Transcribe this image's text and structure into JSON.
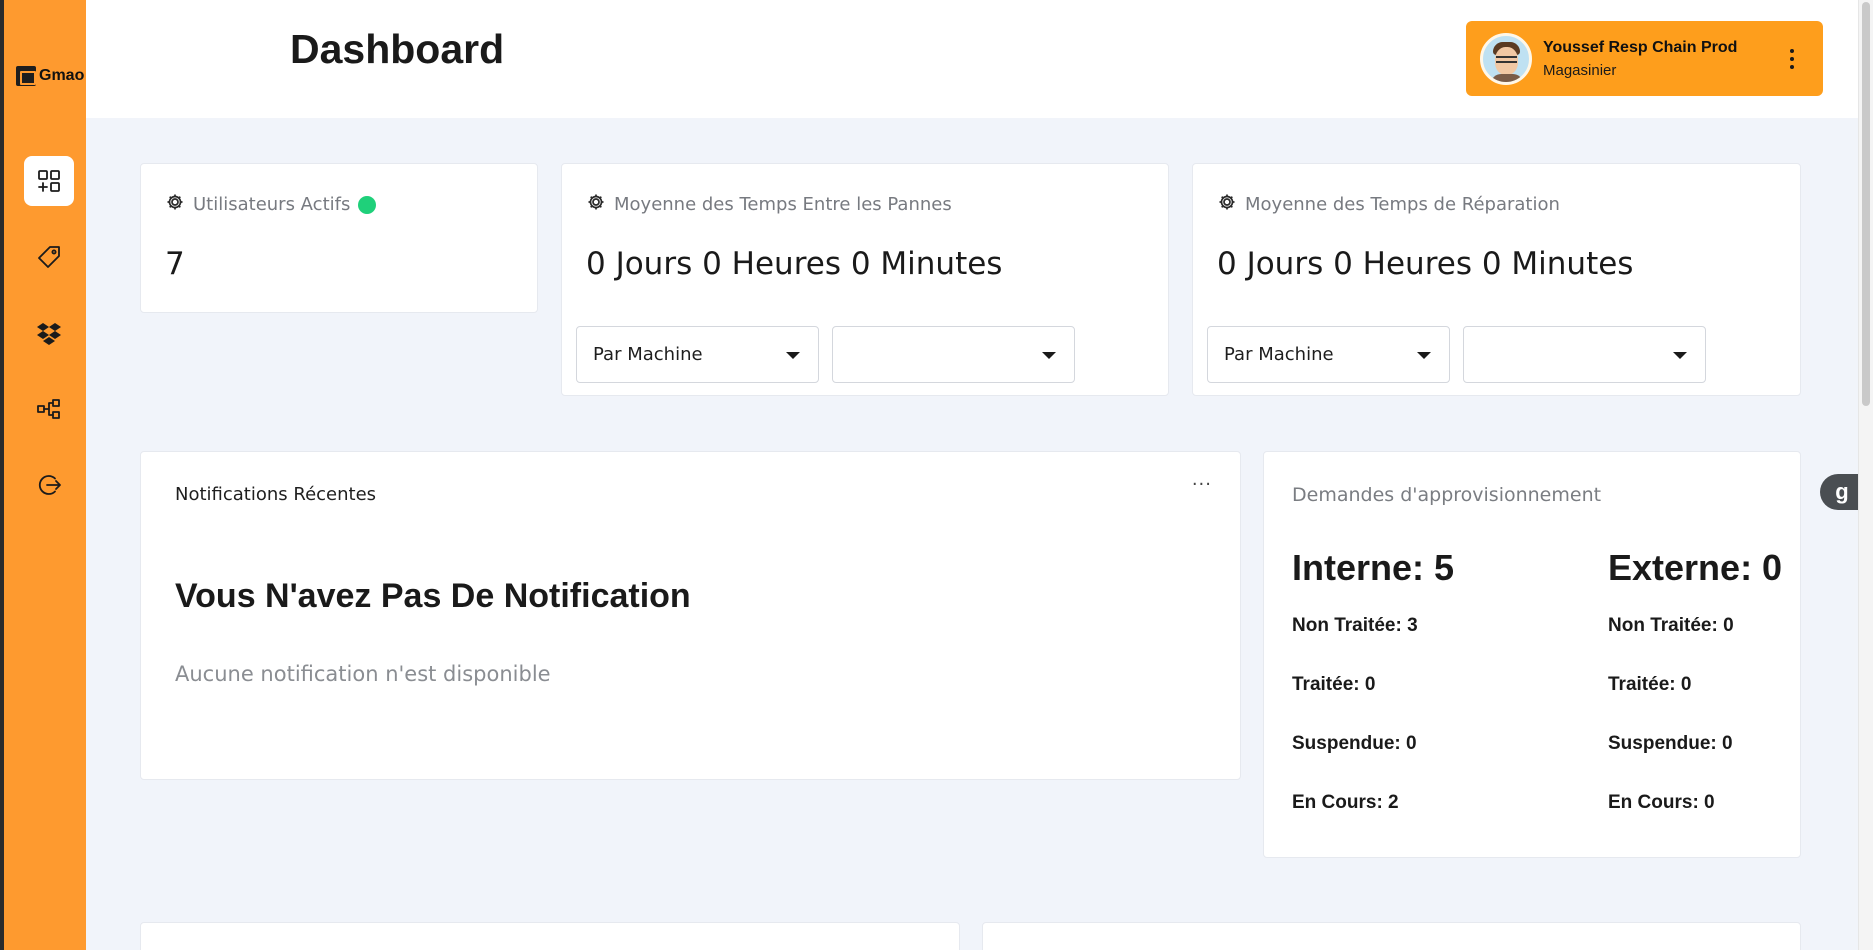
{
  "app": {
    "logo_text": "Gmao",
    "page_title": "Dashboard"
  },
  "sidebar": {
    "items": [
      {
        "name": "dashboard",
        "icon": "dashboard-grid-icon",
        "active": true
      },
      {
        "name": "tag",
        "icon": "tag-icon",
        "active": false
      },
      {
        "name": "dropbox",
        "icon": "boxes-icon",
        "active": false
      },
      {
        "name": "hierarchy",
        "icon": "hierarchy-icon",
        "active": false
      },
      {
        "name": "logout",
        "icon": "logout-icon",
        "active": false
      }
    ]
  },
  "user": {
    "name": "Youssef Resp Chain Prod",
    "role": "Magasinier"
  },
  "stats": {
    "active_users": {
      "label": "Utilisateurs Actifs",
      "value": "7"
    },
    "mtbf": {
      "label": "Moyenne des Temps Entre les Pannes",
      "value": "0 Jours 0 Heures 0 Minutes",
      "filter_type": "Par Machine",
      "filter_value": ""
    },
    "mttr": {
      "label": "Moyenne des Temps de Réparation",
      "value": "0 Jours 0 Heures 0 Minutes",
      "filter_type": "Par Machine",
      "filter_value": ""
    }
  },
  "notifications": {
    "title": "Notifications Récentes",
    "more": "···",
    "empty_title": "Vous N'avez Pas De Notification",
    "empty_text": "Aucune notification n'est disponible"
  },
  "supply": {
    "title": "Demandes d'approvisionnement",
    "internal": {
      "total": "Interne: 5",
      "rows": [
        "Non Traitée: 3",
        "Traitée: 0",
        "Suspendue: 0",
        "En Cours: 2"
      ]
    },
    "external": {
      "total": "Externe: 0",
      "rows": [
        "Non Traitée: 0",
        "Traitée: 0",
        "Suspendue: 0",
        "En Cours: 0"
      ]
    }
  },
  "side_tab": {
    "label": "g"
  },
  "colors": {
    "sidebar": "#fe9a2f",
    "user_card": "#fe9e1c",
    "background": "#f1f4fa",
    "online": "#1fd07a"
  }
}
